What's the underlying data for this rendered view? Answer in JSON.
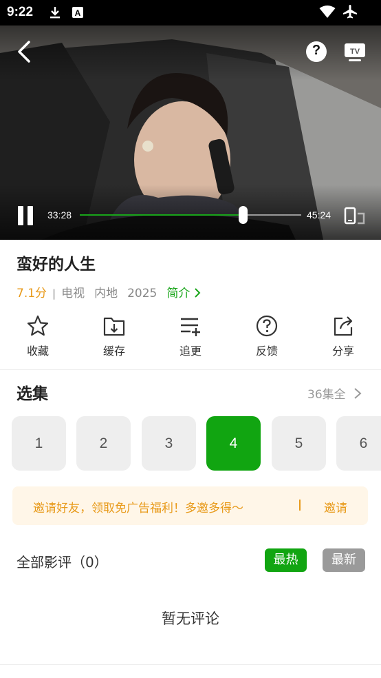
{
  "status_bar": {
    "time": "9:22",
    "left_icons": [
      "download-icon",
      "keyboard-a-icon"
    ],
    "right_icons": [
      "wifi-icon",
      "airplane-mode-icon"
    ]
  },
  "player": {
    "current_time": "33:28",
    "total_time": "45:24",
    "progress": 0.737,
    "accent_color": "#19a51a",
    "help_label": "?",
    "state": "playing"
  },
  "show": {
    "title": "蛮好的人生",
    "score": "7.1分",
    "separator": "|",
    "category": "电视",
    "region": "内地",
    "year": "2025",
    "intro_label": "简介"
  },
  "actions": [
    {
      "label": "收藏",
      "icon": "star-icon"
    },
    {
      "label": "缓存",
      "icon": "download-folder-icon"
    },
    {
      "label": "追更",
      "icon": "playlist-add-icon"
    },
    {
      "label": "反馈",
      "icon": "help-circle-icon"
    },
    {
      "label": "分享",
      "icon": "share-icon"
    }
  ],
  "episodes": {
    "title": "选集",
    "all_label": "36集全",
    "items": [
      "1",
      "2",
      "3",
      "4",
      "5",
      "6"
    ],
    "selected": "4",
    "active_color": "#11a511"
  },
  "banner": {
    "text": "邀请好友，领取免广告福利！多邀多得～",
    "action": "邀请",
    "color": "#e89a1a"
  },
  "comments": {
    "title": "全部影评（0）",
    "sort_hot": "最热",
    "sort_new": "最新",
    "empty_text": "暂无评论"
  }
}
